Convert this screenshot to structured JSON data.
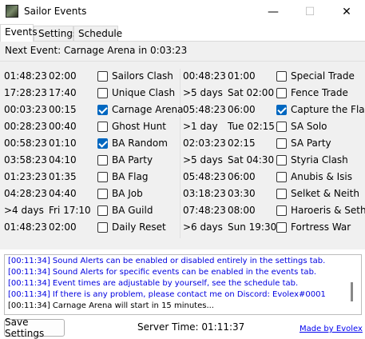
{
  "window": {
    "title": "Sailor Events",
    "minimize_icon": "—",
    "maximize_icon": "☐",
    "close_icon": "✕"
  },
  "tabs": [
    "Events",
    "Settings",
    "Schedule"
  ],
  "next_event": "Next Event: Carnage Arena in 0:03:23",
  "left_events": [
    {
      "countdown": "01:48:23",
      "time": "02:00",
      "name": "Sailors Clash",
      "checked": false
    },
    {
      "countdown": "17:28:23",
      "time": "17:40",
      "name": "Unique Clash",
      "checked": false
    },
    {
      "countdown": "00:03:23",
      "time": "00:15",
      "name": "Carnage Arena",
      "checked": true
    },
    {
      "countdown": "00:28:23",
      "time": "00:40",
      "name": "Ghost Hunt",
      "checked": false
    },
    {
      "countdown": "00:58:23",
      "time": "01:10",
      "name": "BA Random",
      "checked": true
    },
    {
      "countdown": "03:58:23",
      "time": "04:10",
      "name": "BA Party",
      "checked": false
    },
    {
      "countdown": "01:23:23",
      "time": "01:35",
      "name": "BA Flag",
      "checked": false
    },
    {
      "countdown": "04:28:23",
      "time": "04:40",
      "name": "BA Job",
      "checked": false
    },
    {
      "countdown": ">4 days",
      "time": "Fri 17:10",
      "name": "BA Guild",
      "checked": false
    },
    {
      "countdown": "01:48:23",
      "time": "02:00",
      "name": "Daily Reset",
      "checked": false
    }
  ],
  "right_events": [
    {
      "countdown": "00:48:23",
      "time": "01:00",
      "name": "Special Trade",
      "checked": false
    },
    {
      "countdown": ">5 days",
      "time": "Sat 02:00",
      "name": "Fence Trade",
      "checked": false
    },
    {
      "countdown": "05:48:23",
      "time": "06:00",
      "name": "Capture the Flag",
      "checked": true
    },
    {
      "countdown": ">1 day",
      "time": "Tue 02:15",
      "name": "SA Solo",
      "checked": false
    },
    {
      "countdown": "02:03:23",
      "time": "02:15",
      "name": "SA Party",
      "checked": false
    },
    {
      "countdown": ">5 days",
      "time": "Sat 04:30",
      "name": "Styria Clash",
      "checked": false
    },
    {
      "countdown": "05:48:23",
      "time": "06:00",
      "name": "Anubis & Isis",
      "checked": false
    },
    {
      "countdown": "03:18:23",
      "time": "03:30",
      "name": "Selket & Neith",
      "checked": false
    },
    {
      "countdown": "07:48:23",
      "time": "08:00",
      "name": "Haroeris & Seth",
      "checked": false
    },
    {
      "countdown": ">6 days",
      "time": "Sun 19:30",
      "name": "Fortress War",
      "checked": false
    }
  ],
  "log": [
    {
      "text": "[00:11:34] Sound Alerts can be enabled or disabled entirely in the settings tab.",
      "color": "blue"
    },
    {
      "text": "[00:11:34] Sound Alerts for specific events can be enabled in the events tab.",
      "color": "blue"
    },
    {
      "text": "[00:11:34] Event times are adjustable by yourself, see the schedule tab.",
      "color": "blue"
    },
    {
      "text": "[00:11:34] If there is any problem, please contact me on Discord: Evolex#0001",
      "color": "blue"
    },
    {
      "text": "[00:11:34] Carnage Arena will start in 15 minutes...",
      "color": "black"
    }
  ],
  "footer": {
    "save_label": "Save Settings",
    "server_time": "Server Time: 01:11:37",
    "made_by": "Made by Evolex"
  },
  "colors": {
    "checkbox_checked": "#0067c0",
    "log_blue": "#0000e0",
    "link": "#0000ee"
  }
}
